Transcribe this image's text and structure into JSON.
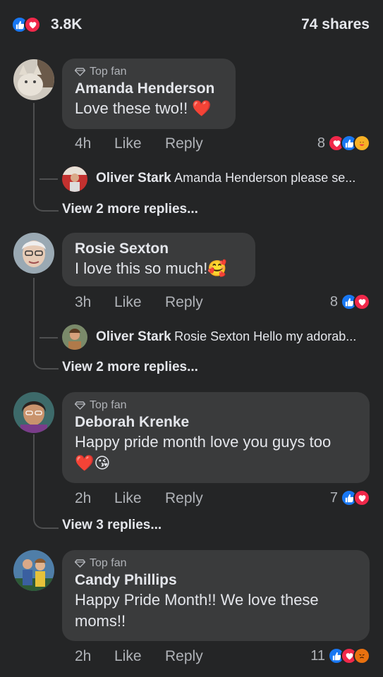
{
  "header": {
    "reaction_count": "3.8K",
    "shares": "74 shares"
  },
  "comments": [
    {
      "top_fan_label": "Top fan",
      "name": "Amanda Henderson",
      "text": "Love these two!! ❤️",
      "time": "4h",
      "like": "Like",
      "reply": "Reply",
      "reaction_count": "8",
      "reply_preview": {
        "name": "Oliver Stark",
        "text": "Amanda Henderson please se..."
      },
      "view_more": "View 2 more replies..."
    },
    {
      "name": "Rosie Sexton",
      "text": "I love this so much!🥰",
      "time": "3h",
      "like": "Like",
      "reply": "Reply",
      "reaction_count": "8",
      "reply_preview": {
        "name": "Oliver Stark",
        "text": "Rosie Sexton Hello my adorab..."
      },
      "view_more": "View 2 more replies..."
    },
    {
      "top_fan_label": "Top fan",
      "name": "Deborah Krenke",
      "text_line1": "Happy pride month love you guys too",
      "text_line2": "❤️😘",
      "time": "2h",
      "like": "Like",
      "reply": "Reply",
      "reaction_count": "7",
      "view_more": "View 3 replies..."
    },
    {
      "top_fan_label": "Top fan",
      "name": "Candy Phillips",
      "text_line1": "Happy Pride Month!! We love these",
      "text_line2": "moms!!",
      "time": "2h",
      "like": "Like",
      "reply": "Reply",
      "reaction_count": "11"
    }
  ],
  "colors": {
    "background": "#242526",
    "bubble": "#3a3b3c",
    "like_blue": "#1877f2",
    "love_red": "#f0284a",
    "muted_text": "#b0b3b8"
  }
}
